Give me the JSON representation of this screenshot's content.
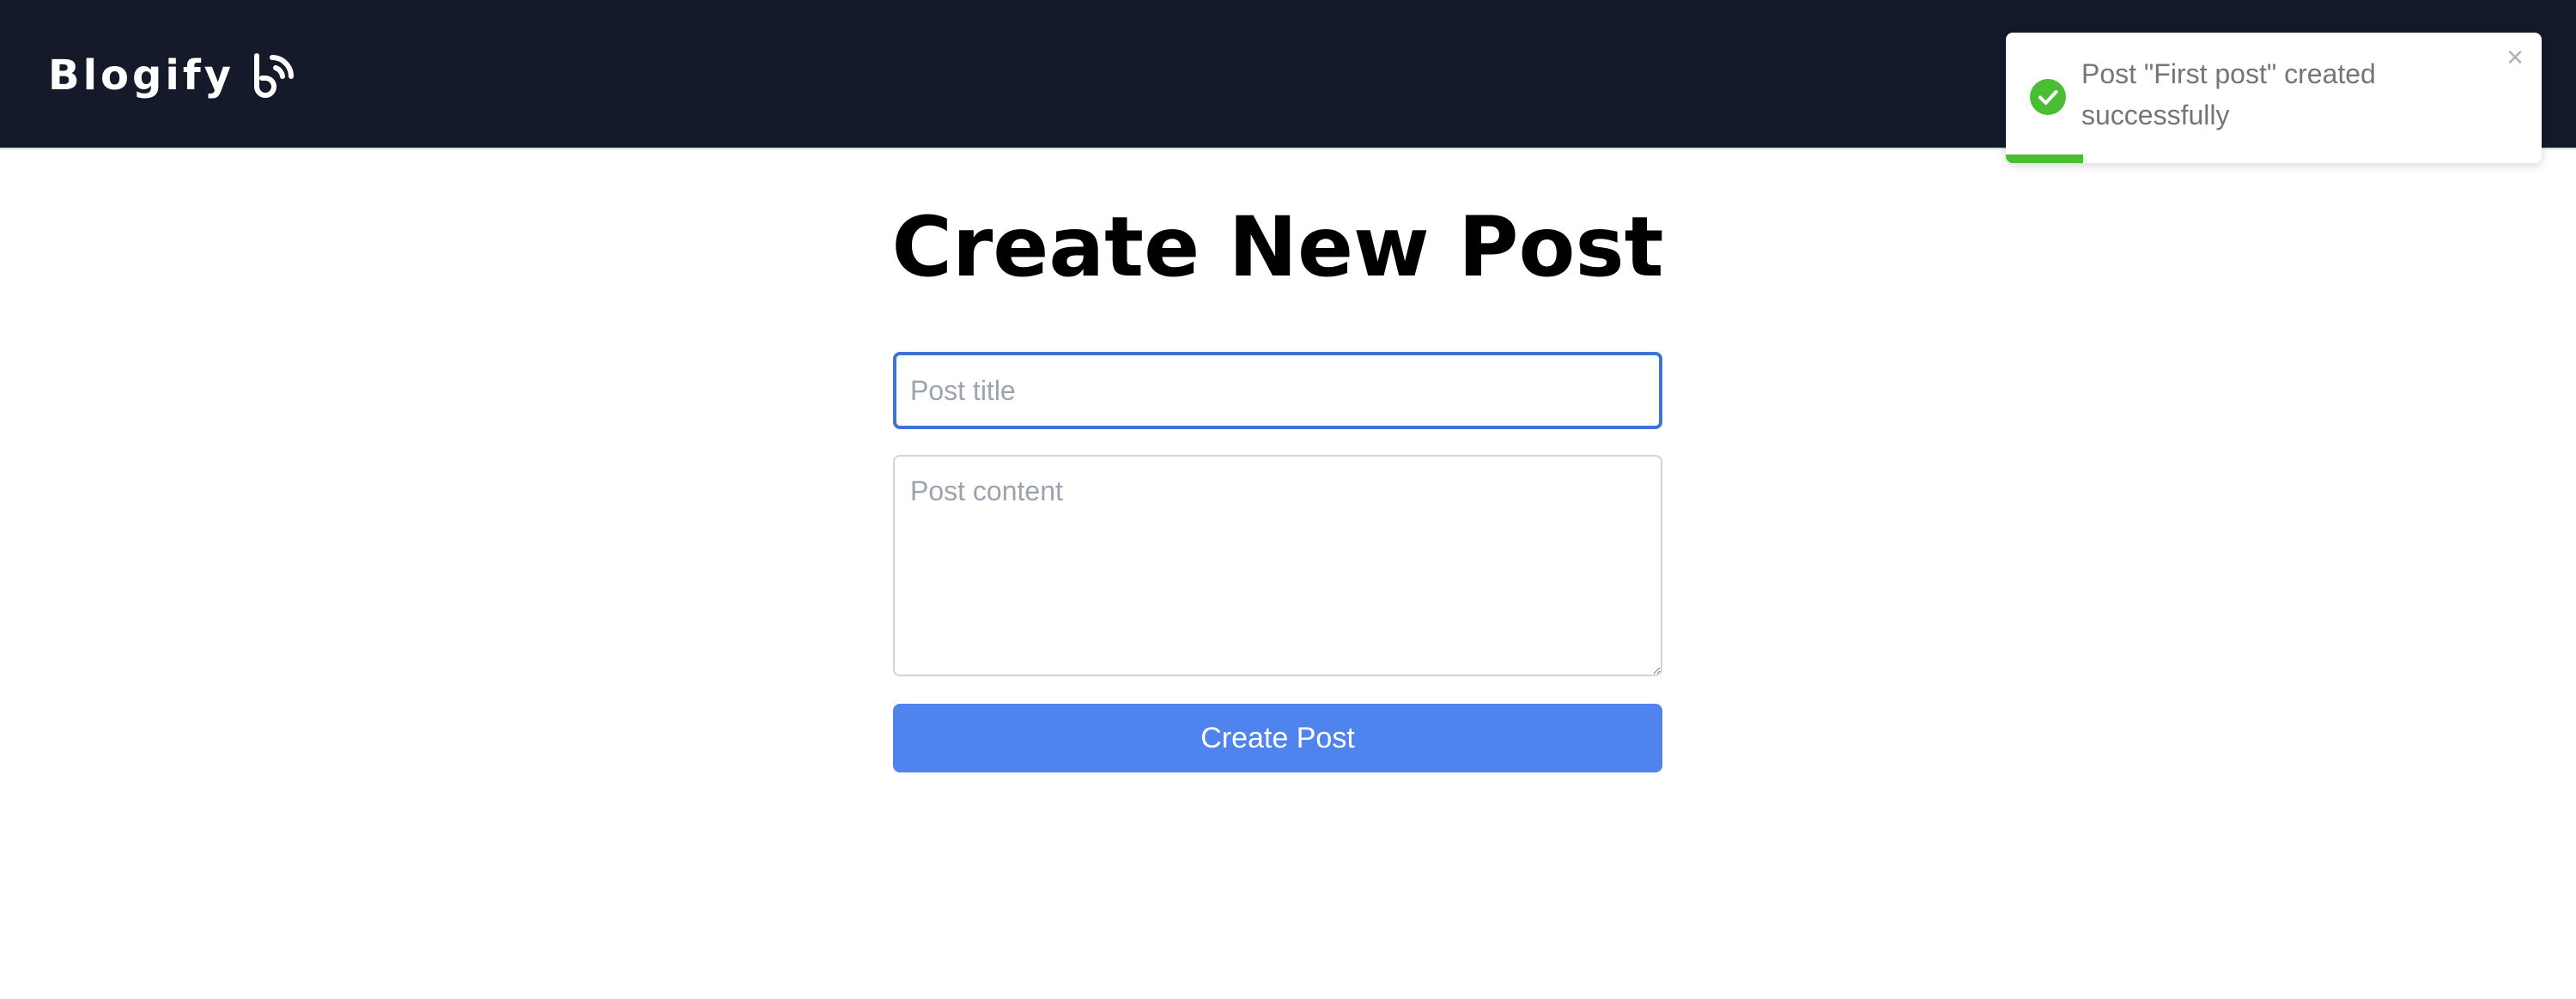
{
  "navbar": {
    "brand": "Blogify",
    "brand_icon": "blog-feed-icon",
    "background": "#141a29"
  },
  "toast": {
    "message": "Post \"First post\" created successfully",
    "status": "success",
    "status_icon": "check-circle-icon",
    "close_icon": "close-icon",
    "close_symbol": "×",
    "accent": "#4bbd34",
    "progress": 0.145
  },
  "main": {
    "title": "Create New Post",
    "form": {
      "title_placeholder": "Post title",
      "title_value": "",
      "content_placeholder": "Post content",
      "content_value": "",
      "submit_label": "Create Post",
      "accent": "#4f84ee"
    }
  }
}
